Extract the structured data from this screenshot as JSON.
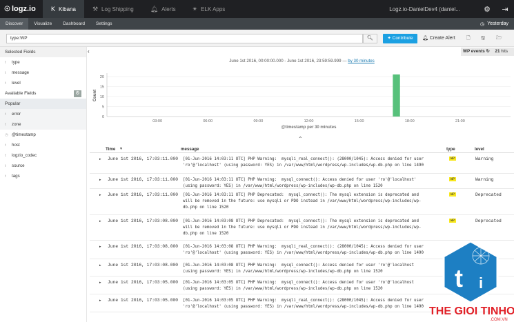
{
  "brand": {
    "logo_text": "logz.io"
  },
  "topnav": {
    "items": [
      {
        "label": "Kibana",
        "icon": "kibana-icon"
      },
      {
        "label": "Log Shipping",
        "icon": "wrench-icon"
      },
      {
        "label": "Alerts",
        "icon": "bell-icon"
      },
      {
        "label": "ELK Apps",
        "icon": "star-icon"
      }
    ],
    "account": "Logz.io-DanielDev4 (daniel..."
  },
  "subnav": {
    "tabs": [
      "Discover",
      "Visualize",
      "Dashboard",
      "Settings"
    ],
    "timepicker": "Yesterday"
  },
  "search": {
    "query": "type:WP",
    "contribute_label": "Contribute",
    "create_alert_label": "Create Alert"
  },
  "sidebar": {
    "selected_header": "Selected Fields",
    "selected_fields": [
      "type",
      "message",
      "level"
    ],
    "available_header": "Available Fields",
    "popular_header": "Popular",
    "popular_fields": [
      "error",
      "zone"
    ],
    "other_fields": [
      "@timestamp",
      "host",
      "logzio_codec",
      "source",
      "tags"
    ]
  },
  "results": {
    "saved_search": "WP events",
    "hits_count": "21",
    "hits_label": "hits",
    "range_text": "June 1st 2016, 00:00:00.000 - June 1st 2016, 23:59:59.999 —",
    "interval_link": "by 30 minutes"
  },
  "chart_data": {
    "type": "bar",
    "xlabel": "@timestamp per 30 minutes",
    "ylabel": "Count",
    "yticks": [
      "0",
      "5",
      "10",
      "15",
      "20"
    ],
    "ylim": [
      0,
      21
    ],
    "xticks": [
      "03:00",
      "06:00",
      "09:00",
      "12:00",
      "15:00",
      "18:00",
      "21:00"
    ],
    "x_hours": [
      3,
      6,
      9,
      12,
      15,
      18,
      21
    ],
    "xlim_hours": [
      0,
      24
    ],
    "bars": [
      {
        "x": "17:00",
        "x_hours": 17.0,
        "value": 21
      }
    ],
    "bar_color": "#57c17b",
    "grid": true
  },
  "table": {
    "headers": {
      "time": "Time",
      "message": "message",
      "type": "type",
      "level": "level"
    },
    "rows": [
      {
        "time": "June 1st 2016, 17:03:11.000",
        "message": "[01-Jun-2016 14:03:11 UTC] PHP Warning:  mysqli_real_connect(): (28000/1045): Access denied for user\n'ro'@'localhost' (using password: YES) in /var/www/html/wordpress/wp-includes/wp-db.php on line 1490",
        "type": "WP",
        "level": "Warning"
      },
      {
        "time": "June 1st 2016, 17:03:11.000",
        "message": "[01-Jun-2016 14:03:11 UTC] PHP Warning:  mysql_connect(): Access denied for user 'ro'@'localhost'\n(using password: YES) in /var/www/html/wordpress/wp-includes/wp-db.php on line 1520",
        "type": "WP",
        "level": "Warning"
      },
      {
        "time": "June 1st 2016, 17:03:11.000",
        "message": "[01-Jun-2016 14:03:11 UTC] PHP Deprecated:  mysql_connect(): The mysql extension is deprecated and\nwill be removed in the future: use mysqli or PDO instead in /var/www/html/wordpress/wp-includes/wp-\ndb.php on line 1520",
        "type": "WP",
        "level": "Deprecated"
      },
      {
        "time": "June 1st 2016, 17:03:08.000",
        "message": "[01-Jun-2016 14:03:08 UTC] PHP Deprecated:  mysql_connect(): The mysql extension is deprecated and\nwill be removed in the future: use mysqli or PDO instead in /var/www/html/wordpress/wp-includes/wp-\ndb.php on line 1520",
        "type": "WP",
        "level": "Deprecated"
      },
      {
        "time": "June 1st 2016, 17:03:08.000",
        "message": "[01-Jun-2016 14:03:08 UTC] PHP Warning:  mysqli_real_connect(): (28000/1045): Access denied for user\n'ro'@'localhost' (using password: YES) in /var/www/html/wordpress/wp-includes/wp-db.php on line 1490",
        "type": "",
        "level": ""
      },
      {
        "time": "June 1st 2016, 17:03:08.000",
        "message": "[01-Jun-2016 14:03:08 UTC] PHP Warning:  mysql_connect(): Access denied for user 'ro'@'localhost\n(using password: YES) in /var/www/html/wordpress/wp-includes/wp-db.php on line 1520",
        "type": "",
        "level": ""
      },
      {
        "time": "June 1st 2016, 17:03:05.000",
        "message": "[01-Jun-2016 14:03:05 UTC] PHP Warning:  mysql_connect(): Access denied for user 'ro'@'localhost\n(using password: YES) in /var/www/html/wordpress/wp-includes/wp-db.php on line 1520",
        "type": "",
        "level": ""
      },
      {
        "time": "June 1st 2016, 17:03:05.000",
        "message": "[01-Jun-2016 14:03:05 UTC] PHP Warning:  mysqli_real_connect(): (28000/1045): Access denied for user\n'ro'@'localhost' (using password: YES) in /var/www/html/wordpress/wp-includes/wp-db.php on line 1490",
        "type": "",
        "level": ""
      }
    ]
  },
  "watermark": {
    "text": "THE GIOI TINHOC",
    "domain": ".COM.VN",
    "color": "#e11f26",
    "tile_color": "#1d7fc3"
  }
}
